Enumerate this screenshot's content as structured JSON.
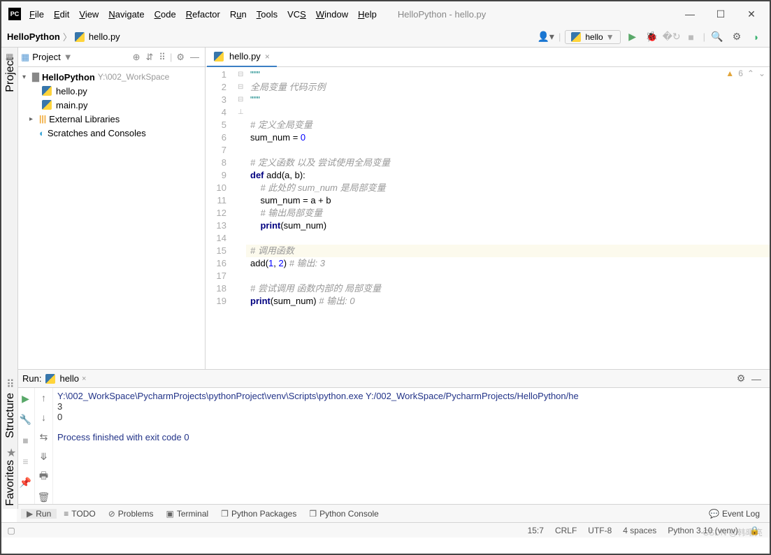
{
  "title_bar": {
    "window_title": "HelloPython - hello.py",
    "menus": [
      "File",
      "Edit",
      "View",
      "Navigate",
      "Code",
      "Refactor",
      "Run",
      "Tools",
      "VCS",
      "Window",
      "Help"
    ]
  },
  "nav": {
    "breadcrumb_project": "HelloPython",
    "breadcrumb_file": "hello.py",
    "run_config": "hello"
  },
  "project_panel": {
    "header": "Project",
    "root_name": "HelloPython",
    "root_path": "Y:\\002_WorkSpace",
    "files": [
      "hello.py",
      "main.py"
    ],
    "external": "External Libraries",
    "scratches": "Scratches and Consoles"
  },
  "editor": {
    "tab_name": "hello.py",
    "warn_count": "6",
    "lines": [
      {
        "n": 1,
        "t": "quote",
        "c": "\"\"\""
      },
      {
        "n": 2,
        "t": "cmt",
        "c": "全局变量 代码示例"
      },
      {
        "n": 3,
        "t": "quote",
        "c": "\"\"\""
      },
      {
        "n": 4,
        "t": "blank",
        "c": ""
      },
      {
        "n": 5,
        "t": "cmt",
        "c": "# 定义全局变量"
      },
      {
        "n": 6,
        "t": "code",
        "c": "sum_num = 0"
      },
      {
        "n": 7,
        "t": "blank",
        "c": ""
      },
      {
        "n": 8,
        "t": "cmt",
        "c": "# 定义函数 以及 尝试使用全局变量"
      },
      {
        "n": 9,
        "t": "def",
        "c": "def add(a, b):"
      },
      {
        "n": 10,
        "t": "cmt_i",
        "c": "    # 此处的 sum_num 是局部变量"
      },
      {
        "n": 11,
        "t": "code_i",
        "c": "    sum_num = a + b"
      },
      {
        "n": 12,
        "t": "cmt_i",
        "c": "    # 输出局部变量"
      },
      {
        "n": 13,
        "t": "code_i2",
        "c": "    print(sum_num)"
      },
      {
        "n": 14,
        "t": "blank",
        "c": ""
      },
      {
        "n": 15,
        "t": "cmt",
        "c": "# 调用函数"
      },
      {
        "n": 16,
        "t": "call",
        "c": "add(1, 2) # 输出: 3"
      },
      {
        "n": 17,
        "t": "blank",
        "c": ""
      },
      {
        "n": 18,
        "t": "cmt",
        "c": "# 尝试调用 函数内部的 局部变量"
      },
      {
        "n": 19,
        "t": "call2",
        "c": "print(sum_num) # 输出: 0"
      }
    ]
  },
  "run": {
    "label": "Run:",
    "tab": "hello",
    "output_path": "Y:\\002_WorkSpace\\PycharmProjects\\pythonProject\\venv\\Scripts\\python.exe Y:/002_WorkSpace/PycharmProjects/HelloPython/he",
    "out1": "3",
    "out2": "0",
    "finished": "Process finished with exit code 0"
  },
  "bottom": {
    "run": "Run",
    "todo": "TODO",
    "problems": "Problems",
    "terminal": "Terminal",
    "packages": "Python Packages",
    "console": "Python Console",
    "event_log": "Event Log"
  },
  "status": {
    "pos": "15:7",
    "eol": "CRLF",
    "enc": "UTF-8",
    "indent": "4 spaces",
    "interp": "Python 3.10 (venv)"
  },
  "sidebar": {
    "project": "Project",
    "structure": "Structure",
    "favorites": "Favorites"
  },
  "watermark": "CSDN @韩曙亮"
}
